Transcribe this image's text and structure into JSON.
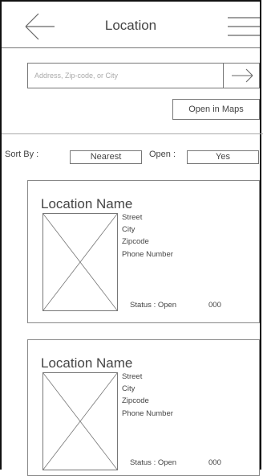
{
  "header": {
    "title": "Location",
    "back_icon": "back-arrow-icon",
    "menu_icon": "hamburger-menu-icon"
  },
  "search": {
    "placeholder": "Address, Zip-code, or City",
    "go_icon": "arrow-right-icon"
  },
  "maps_button": {
    "label": "Open in Maps"
  },
  "filters": {
    "sort_label": "Sort By :",
    "sort_value": "Nearest",
    "open_label": "Open :",
    "open_value": "Yes"
  },
  "locations": [
    {
      "name": "Location Name",
      "street": "Street",
      "city": "City",
      "zipcode": "Zipcode",
      "phone": "Phone Number",
      "status": "Status : Open",
      "number": "000",
      "image_icon": "image-placeholder-icon"
    },
    {
      "name": "Location Name",
      "street": "Street",
      "city": "City",
      "zipcode": "Zipcode",
      "phone": "Phone Number",
      "status": "Status : Open",
      "number": "000",
      "image_icon": "image-placeholder-icon"
    }
  ]
}
